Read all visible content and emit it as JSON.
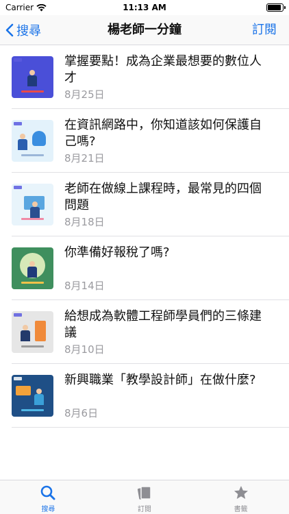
{
  "status_bar": {
    "carrier": "Carrier",
    "time": "11:13 AM"
  },
  "nav": {
    "back_label": "搜尋",
    "title": "楊老師一分鐘",
    "subscribe_label": "訂閱"
  },
  "episodes": [
    {
      "title": "掌握要點！成為企業最想要的數位人才",
      "date": "8月25日",
      "thumb_color": "#4a4fd8"
    },
    {
      "title": "在資訊網路中，你知道該如何保護自己嗎?",
      "date": "8月21日",
      "thumb_color": "#e3f2fb"
    },
    {
      "title": "老師在做線上課程時，最常見的四個問題",
      "date": "8月18日",
      "thumb_color": "#e8f4fb"
    },
    {
      "title": "你準備好報稅了嗎?",
      "date": "8月14日",
      "thumb_color": "#3f8f5e"
    },
    {
      "title": "給想成為軟體工程師學員們的三條建議",
      "date": "8月10日",
      "thumb_color": "#e6e6e6"
    },
    {
      "title": "新興職業「教學設計師」在做什麼?",
      "date": "8月6日",
      "thumb_color": "#1f4f86"
    }
  ],
  "tabs": [
    {
      "label": "搜尋",
      "icon": "search-icon",
      "active": true
    },
    {
      "label": "訂閱",
      "icon": "stack-icon",
      "active": false
    },
    {
      "label": "書籤",
      "icon": "star-icon",
      "active": false
    }
  ],
  "colors": {
    "accent": "#1a73e8",
    "date_gray": "#9a9a9f",
    "tab_gray": "#8e8e93"
  }
}
